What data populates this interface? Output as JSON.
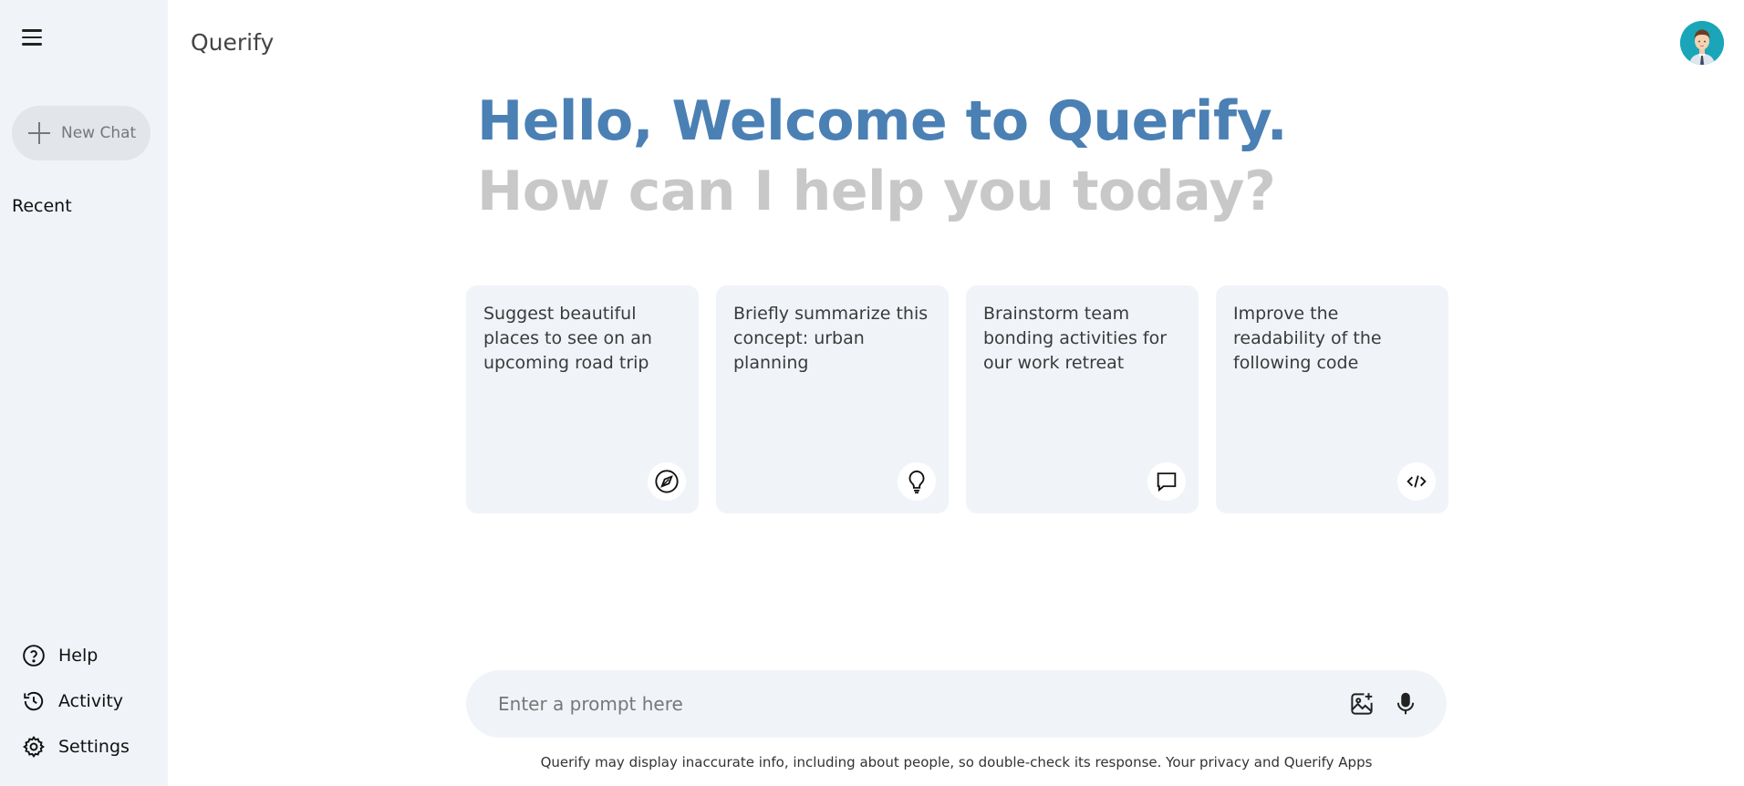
{
  "app": {
    "brand": "Querify"
  },
  "sidebar": {
    "new_chat_label": "New Chat",
    "recent_title": "Recent",
    "bottom_items": [
      {
        "label": "Help",
        "icon": "help-circle-icon"
      },
      {
        "label": "Activity",
        "icon": "history-icon"
      },
      {
        "label": "Settings",
        "icon": "gear-icon"
      }
    ]
  },
  "greeting": {
    "line1": "Hello, Welcome to Querify.",
    "line2": "How can I help you today?"
  },
  "cards": [
    {
      "text": "Suggest beautiful places to see on an upcoming road trip",
      "icon": "compass-icon"
    },
    {
      "text": "Briefly summarize this concept: urban planning",
      "icon": "lightbulb-icon"
    },
    {
      "text": "Brainstorm team bonding activities for our work retreat",
      "icon": "chat-bubble-icon"
    },
    {
      "text": "Improve the readability of the following code",
      "icon": "code-icon"
    }
  ],
  "prompt": {
    "placeholder": "Enter a prompt here",
    "image_icon": "image-add-icon",
    "mic_icon": "microphone-icon"
  },
  "disclaimer": "Querify may display inaccurate info, including about people, so double-check its response. Your privacy and Querify Apps",
  "colors": {
    "accent": "#4a80b4",
    "muted_heading": "#c8c8c8",
    "sidebar_bg": "#f0f4f9",
    "avatar_bg": "#1aa6b8"
  }
}
